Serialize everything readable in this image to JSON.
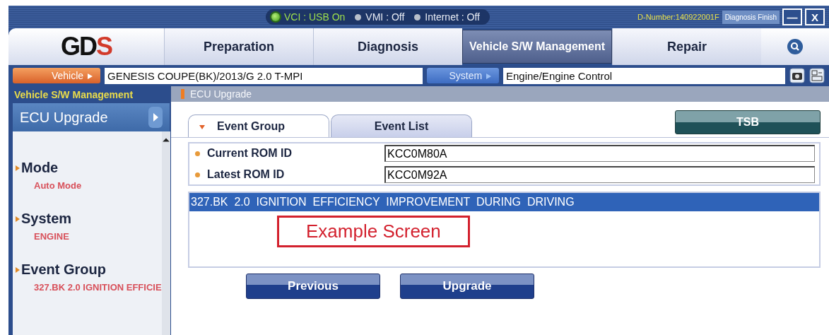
{
  "status": [
    {
      "label": "VCI : USB On",
      "on": true
    },
    {
      "label": "VMI : Off",
      "on": false
    },
    {
      "label": "Internet : Off",
      "on": false
    }
  ],
  "d_number": "D-Number:140922001F",
  "finish_button": "Diagnosis Finish",
  "window_buttons": [
    "—",
    "X"
  ],
  "logo": [
    "GD",
    "S"
  ],
  "nav_tabs": [
    {
      "label": "Preparation",
      "selected": false
    },
    {
      "label": "Diagnosis",
      "selected": false
    },
    {
      "label": "Vehicle S/W Management",
      "selected": true
    },
    {
      "label": "Repair",
      "selected": false
    }
  ],
  "vehicle": {
    "label": "Vehicle",
    "value": "GENESIS COUPE(BK)/2013/G 2.0 T-MPI"
  },
  "system": {
    "label": "System",
    "value": "Engine/Engine Control"
  },
  "sidebar": {
    "title": "Vehicle S/W Management",
    "menu": {
      "label": "ECU Upgrade",
      "selected": true
    },
    "items": [
      {
        "label": "Mode",
        "value": "Auto Mode"
      },
      {
        "label": "System",
        "value": "ENGINE"
      },
      {
        "label": "Event Group",
        "value": "327.BK 2.0 IGNITION EFFICIE"
      }
    ]
  },
  "breadcrumb": "ECU Upgrade",
  "tabs": [
    {
      "label": "Event Group",
      "selected": true
    },
    {
      "label": "Event List",
      "selected": false
    }
  ],
  "tsb_button": "TSB",
  "fields": [
    {
      "label": "Current ROM ID",
      "value": "KCC0M80A"
    },
    {
      "label": "Latest ROM ID",
      "value": "KCC0M92A"
    }
  ],
  "events": [
    {
      "label": "327.BK  2.0  IGNITION  EFFICIENCY  IMPROVEMENT  DURING  DRIVING",
      "selected": true
    }
  ],
  "note": "Example Screen",
  "buttons": [
    "Previous",
    "Upgrade"
  ]
}
